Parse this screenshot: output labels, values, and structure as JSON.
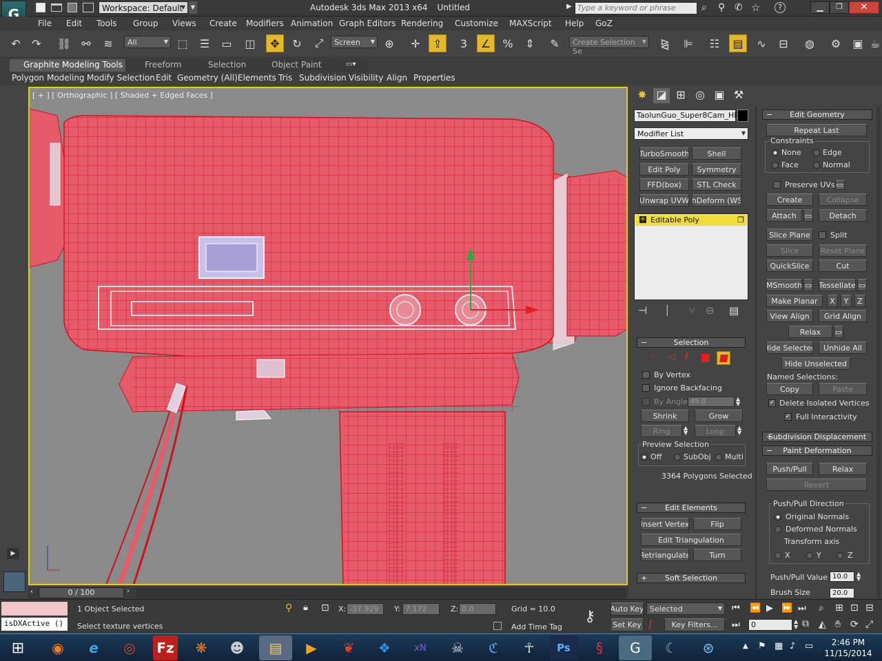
{
  "titlebar": {
    "workspace": "Workspace: Default",
    "title": "Autodesk 3ds Max  2013 x64",
    "doc": "Untitled",
    "search_placeholder": "Type a keyword or phrase"
  },
  "menu": [
    "File",
    "Edit",
    "Tools",
    "Group",
    "Views",
    "Create",
    "Modifiers",
    "Animation",
    "Graph Editors",
    "Rendering",
    "Customize",
    "MAXScript",
    "Help",
    "GoZ"
  ],
  "toolbar": {
    "filter": "All",
    "coord": "Screen",
    "selection_set_placeholder": "Create Selection Se"
  },
  "ribbon": {
    "tabs": [
      "Graphite Modeling Tools",
      "Freeform",
      "Selection",
      "Object Paint"
    ],
    "items": [
      "Polygon Modeling",
      "Modify Selection",
      "Edit",
      "Geometry (All)",
      "Elements",
      "Tris",
      "Subdivision",
      "Visibility",
      "Align",
      "Properties"
    ]
  },
  "viewport": {
    "label": "[ + ] [ Orthographic ] [ Shaded  + Edged Faces ]"
  },
  "timeline": {
    "frame": "0 / 100"
  },
  "modifier": {
    "object_name": "TaolunGuo_Super8Cam_HP",
    "list_label": "Modifier List",
    "buttons": [
      "TurboSmooth",
      "Shell",
      "Edit Poly",
      "Symmetry",
      "FFD(box)",
      "STL Check",
      "Unwrap UVW",
      "thDeform (WSI"
    ],
    "stack_item": "Editable Poly"
  },
  "selection_roll": {
    "title": "Selection",
    "by_vertex": "By Vertex",
    "ignore_backfacing": "Ignore Backfacing",
    "by_angle": "By Angle:",
    "angle_value": "45.0",
    "shrink": "Shrink",
    "grow": "Grow",
    "ring": "Ring",
    "loop": "Loop",
    "preview_title": "Preview Selection",
    "preview_opts": [
      "Off",
      "SubObj",
      "Multi"
    ],
    "status": "3364 Polygons Selected"
  },
  "edit_elements": {
    "title": "Edit Elements",
    "insert_vertex": "Insert Vertex",
    "flip": "Flip",
    "edit_triangulation": "Edit Triangulation",
    "retriangulate": "Retriangulate",
    "turn": "Turn"
  },
  "soft_selection": {
    "title": "Soft Selection"
  },
  "edit_geometry": {
    "title": "Edit Geometry",
    "repeat_last": "Repeat Last",
    "constraints_title": "Constraints",
    "constraints": [
      "None",
      "Edge",
      "Face",
      "Normal"
    ],
    "preserve_uvs": "Preserve UVs",
    "create": "Create",
    "collapse": "Collapse",
    "attach": "Attach",
    "detach": "Detach",
    "slice_plane": "Slice Plane",
    "split": "Split",
    "slice": "Slice",
    "reset_plane": "Reset Plane",
    "quickslice": "QuickSlice",
    "cut": "Cut",
    "msmooth": "MSmooth",
    "tessellate": "Tessellate",
    "make_planar": "Make Planar",
    "x": "X",
    "y": "Y",
    "z": "Z",
    "view_align": "View Align",
    "grid_align": "Grid Align",
    "relax": "Relax",
    "hide_selected": "Hide Selected",
    "unhide_all": "Unhide All",
    "hide_unselected": "Hide Unselected",
    "named_selections": "Named Selections:",
    "copy": "Copy",
    "paste": "Paste",
    "delete_isolated": "Delete Isolated Vertices",
    "full_interactivity": "Full Interactivity"
  },
  "subdivision_displacement": {
    "title": "Subdivision Displacement"
  },
  "paint_deformation": {
    "title": "Paint Deformation",
    "push_pull": "Push/Pull",
    "relax": "Relax",
    "revert": "Revert",
    "direction_title": "Push/Pull Direction",
    "original_normals": "Original Normals",
    "deformed_normals": "Deformed Normals",
    "transform_axis": "Transform axis",
    "axes": [
      "X",
      "Y",
      "Z"
    ],
    "push_pull_value_label": "Push/Pull Value",
    "push_pull_value": "10.0",
    "brush_size_label": "Brush Size",
    "brush_size": "20.0"
  },
  "status": {
    "listener": "isDXActive ()",
    "objects_selected": "1 Object Selected",
    "prompt": "Select texture vertices",
    "x_label": "X:",
    "x_value": "-37.929",
    "y_label": "Y:",
    "y_value": "7.172",
    "z_label": "Z:",
    "z_value": "0.0",
    "grid": "Grid = 10.0",
    "add_time_tag": "Add Time Tag",
    "auto_key": "Auto Key",
    "set_key": "Set Key",
    "key_mode": "Selected",
    "key_filters": "Key Filters...",
    "frame": "0"
  },
  "taskbar": {
    "time": "2:46 PM",
    "date": "11/15/2014"
  },
  "colors": {
    "accent_yellow": "#e8d000",
    "mesh_red": "#e65a6a",
    "wire": "#d01020"
  }
}
